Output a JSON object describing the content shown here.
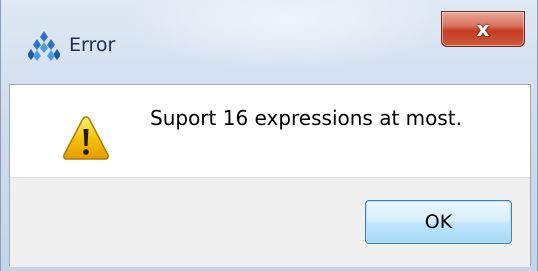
{
  "dialog": {
    "title": "Error",
    "close_label": "x",
    "message": "Suport 16 expressions at most.",
    "ok_label": "OK",
    "icon": "warning-icon",
    "app_icon": "gowin-logo-icon"
  },
  "colors": {
    "accent": "#3c7fb1",
    "close_red": "#c43c22",
    "warning_yellow": "#f5c400"
  }
}
